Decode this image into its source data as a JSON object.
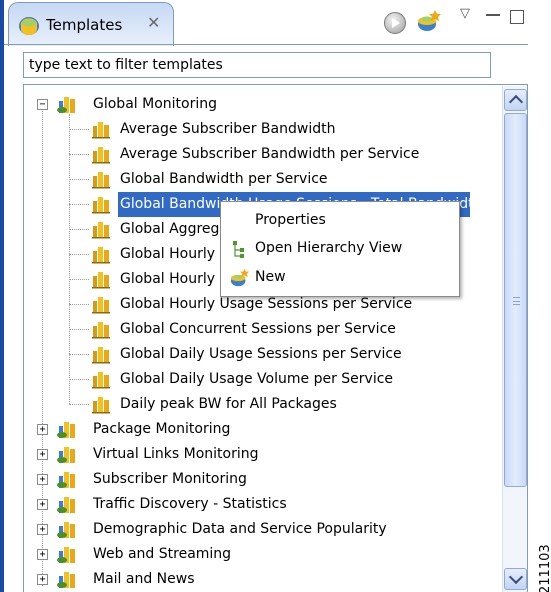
{
  "view": {
    "tab_title": "Templates",
    "tab_close_glyph": "✕",
    "toolbar": {
      "run_icon": "run-icon",
      "new_icon": "new-template-icon",
      "menu_glyph": "▽"
    }
  },
  "filter": {
    "value": "type text to filter templates",
    "placeholder": "type text to filter templates"
  },
  "tree": {
    "root": {
      "label": "Global Monitoring",
      "expander": "−",
      "children": [
        "Average Subscriber Bandwidth",
        "Average Subscriber Bandwidth per Service",
        "Global Bandwidth per Service",
        "Global Bandwidth Usage Sessions - Total Bandwidth",
        "Global Aggregated",
        "Global Hourly",
        "Global Hourly",
        "Global Hourly Usage Sessions per Service",
        "Global Concurrent Sessions per Service",
        "Global Daily Usage Sessions per Service",
        "Global Daily Usage Volume per Service",
        "Daily peak BW for All Packages"
      ]
    },
    "selected_item": "Global Bandwidth Usage Sessions - Total Bandwidth",
    "groups": [
      {
        "label": "Package Monitoring",
        "expander": "+"
      },
      {
        "label": "Virtual Links Monitoring",
        "expander": "+"
      },
      {
        "label": "Subscriber Monitoring",
        "expander": "+"
      },
      {
        "label": "Traffic Discovery - Statistics",
        "expander": "+"
      },
      {
        "label": "Demographic Data and Service Popularity",
        "expander": "+"
      },
      {
        "label": "Web and Streaming",
        "expander": "+"
      },
      {
        "label": "Mail and News",
        "expander": "+"
      }
    ]
  },
  "context_menu": {
    "items": [
      {
        "label": "Properties",
        "icon": ""
      },
      {
        "label": "Open Hierarchy View",
        "icon": "hierarchy-icon"
      },
      {
        "label": "New",
        "icon": "new-template-icon"
      }
    ]
  },
  "figure_id": "211103",
  "colors": {
    "selection": "#316ac5",
    "tab_gradient_top": "#c6d8f4",
    "accent": "#1a4aa8"
  }
}
